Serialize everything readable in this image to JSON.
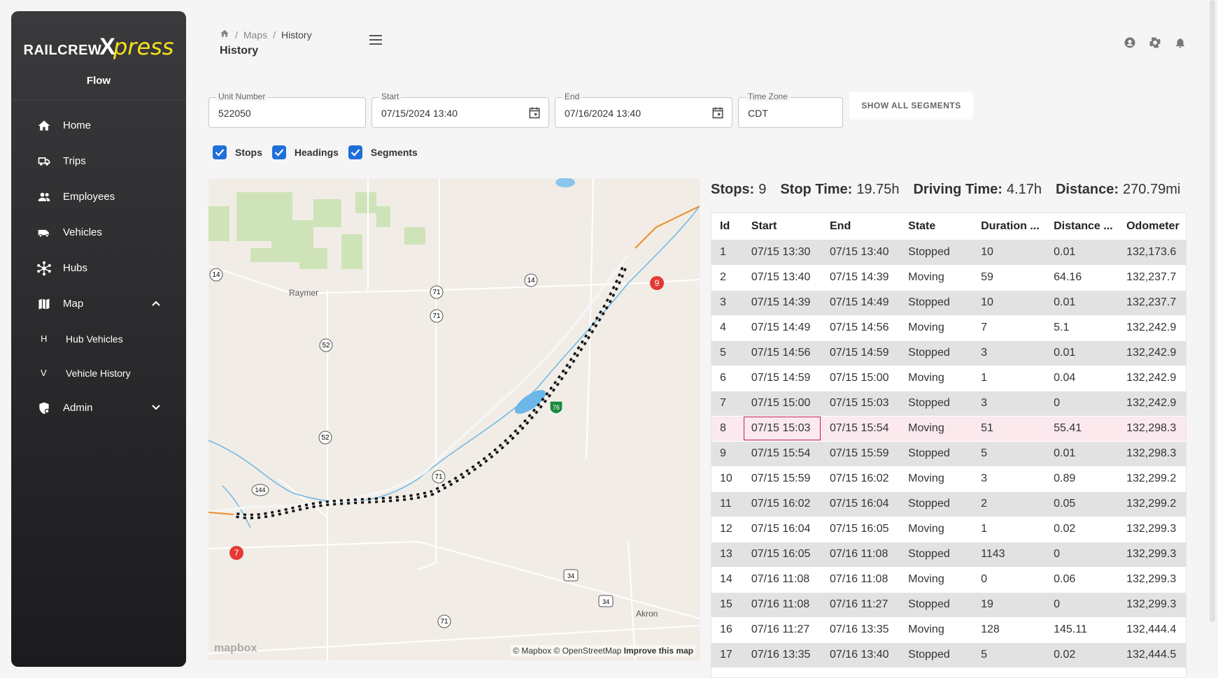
{
  "brand": {
    "logo_left": "RAILCREW",
    "logo_x": "X",
    "logo_right": "press",
    "app_name": "Flow"
  },
  "sidebar": {
    "items": [
      {
        "label": "Home",
        "icon": "home-icon"
      },
      {
        "label": "Trips",
        "icon": "truck-icon"
      },
      {
        "label": "Employees",
        "icon": "people-icon"
      },
      {
        "label": "Vehicles",
        "icon": "van-icon"
      },
      {
        "label": "Hubs",
        "icon": "hub-icon"
      },
      {
        "label": "Map",
        "icon": "map-icon"
      },
      {
        "label": "Admin",
        "icon": "admin-icon"
      }
    ],
    "sub_items": [
      {
        "letter": "H",
        "label": "Hub Vehicles"
      },
      {
        "letter": "V",
        "label": "Vehicle History"
      }
    ]
  },
  "header": {
    "breadcrumb": [
      "Maps",
      "History"
    ],
    "title": "History"
  },
  "filters": {
    "unit_label": "Unit Number",
    "unit_value": "522050",
    "start_label": "Start",
    "start_value": "07/15/2024 13:40",
    "end_label": "End",
    "end_value": "07/16/2024 13:40",
    "tz_label": "Time Zone",
    "tz_value": "CDT",
    "segments_button": "SHOW ALL SEGMENTS"
  },
  "toggles": {
    "stops": "Stops",
    "headings": "Headings",
    "segments": "Segments"
  },
  "map": {
    "places": {
      "raymer": "Raymer",
      "akron": "Akron"
    },
    "shields": {
      "r14a": "14",
      "r14b": "14",
      "r71a": "71",
      "r71b": "71",
      "r71c": "71",
      "r71d": "71",
      "r52a": "52",
      "r52b": "52",
      "r144": "144",
      "r34a": "34",
      "r34b": "34",
      "i76": "76"
    },
    "markers": {
      "start": "7",
      "end": "9"
    },
    "attribution_prefix": "© Mapbox © OpenStreetMap",
    "attribution_link": "Improve this map",
    "logo_text": "mapbox"
  },
  "summary": {
    "stops_label": "Stops:",
    "stops_value": "9",
    "stop_time_label": "Stop Time:",
    "stop_time_value": "19.75h",
    "driving_label": "Driving Time:",
    "driving_value": "4.17h",
    "distance_label": "Distance:",
    "distance_value": "270.79mi"
  },
  "table": {
    "columns": [
      "Id",
      "Start",
      "End",
      "State",
      "Duration ...",
      "Distance ...",
      "Odometer"
    ],
    "rows": [
      [
        "1",
        "07/15 13:30",
        "07/15 13:40",
        "Stopped",
        "10",
        "0.01",
        "132,173.6"
      ],
      [
        "2",
        "07/15 13:40",
        "07/15 14:39",
        "Moving",
        "59",
        "64.16",
        "132,237.7"
      ],
      [
        "3",
        "07/15 14:39",
        "07/15 14:49",
        "Stopped",
        "10",
        "0.01",
        "132,237.7"
      ],
      [
        "4",
        "07/15 14:49",
        "07/15 14:56",
        "Moving",
        "7",
        "5.1",
        "132,242.9"
      ],
      [
        "5",
        "07/15 14:56",
        "07/15 14:59",
        "Stopped",
        "3",
        "0.01",
        "132,242.9"
      ],
      [
        "6",
        "07/15 14:59",
        "07/15 15:00",
        "Moving",
        "1",
        "0.04",
        "132,242.9"
      ],
      [
        "7",
        "07/15 15:00",
        "07/15 15:03",
        "Stopped",
        "3",
        "0",
        "132,242.9"
      ],
      [
        "8",
        "07/15 15:03",
        "07/15 15:54",
        "Moving",
        "51",
        "55.41",
        "132,298.3"
      ],
      [
        "9",
        "07/15 15:54",
        "07/15 15:59",
        "Stopped",
        "5",
        "0.01",
        "132,298.3"
      ],
      [
        "10",
        "07/15 15:59",
        "07/15 16:02",
        "Moving",
        "3",
        "0.89",
        "132,299.2"
      ],
      [
        "11",
        "07/15 16:02",
        "07/15 16:04",
        "Stopped",
        "2",
        "0.05",
        "132,299.2"
      ],
      [
        "12",
        "07/15 16:04",
        "07/15 16:05",
        "Moving",
        "1",
        "0.02",
        "132,299.3"
      ],
      [
        "13",
        "07/15 16:05",
        "07/16 11:08",
        "Stopped",
        "1143",
        "0",
        "132,299.3"
      ],
      [
        "14",
        "07/16 11:08",
        "07/16 11:08",
        "Moving",
        "0",
        "0.06",
        "132,299.3"
      ],
      [
        "15",
        "07/16 11:08",
        "07/16 11:27",
        "Stopped",
        "19",
        "0",
        "132,299.3"
      ],
      [
        "16",
        "07/16 11:27",
        "07/16 13:35",
        "Moving",
        "128",
        "145.11",
        "132,444.4"
      ],
      [
        "17",
        "07/16 13:35",
        "07/16 13:40",
        "Stopped",
        "5",
        "0.02",
        "132,444.5"
      ]
    ],
    "selected_row": 7
  }
}
